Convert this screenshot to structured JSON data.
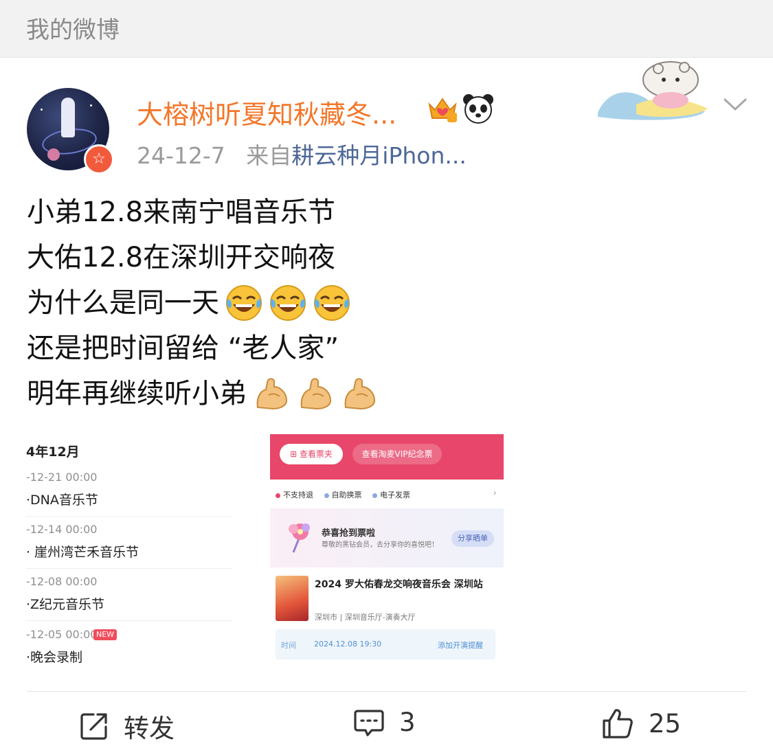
{
  "header": {
    "title": "我的微博"
  },
  "post": {
    "author": {
      "name": "大榕树听夏知秋藏冬...",
      "verified_badge": "☆",
      "badges": [
        "crown-icon",
        "panda-icon"
      ]
    },
    "date": "24-12-7",
    "source_prefix": "来自",
    "source": "耕云种月iPhon...",
    "lines": [
      "小弟12.8来南宁唱音乐节",
      "大佑12.8在深圳开交响夜",
      "为什么是同一天",
      "还是把时间留给 “老人家”",
      "明年再继续听小弟"
    ],
    "line3_emoji": "laughing-crying-emoji",
    "line5_emoji": "flexed-biceps-emoji"
  },
  "left_image": {
    "month": "4年12月",
    "events": [
      {
        "date": "-12-21 00:00",
        "name": "·DNA音乐节",
        "new": false
      },
      {
        "date": "-12-14 00:00",
        "name": "· 崖州湾芒禾音乐节",
        "new": false
      },
      {
        "date": "-12-08 00:00",
        "name": "·Z纪元音乐节",
        "new": false
      },
      {
        "date": "-12-05 00:00",
        "name": "·晚会录制",
        "new": true
      }
    ],
    "new_label": "NEW"
  },
  "right_image": {
    "btn_ticket": "⊞ 查看票夹",
    "btn_vip": "查看淘麦VIP纪念票",
    "tags": [
      "不支持退",
      "自助换票",
      "电子发票"
    ],
    "success_title": "恭喜抢到票啦",
    "success_sub": "尊敬的黑钻会员，去分享你的喜悦吧！",
    "share_label": "分享晒单",
    "concert_title": "2024 罗大佑春龙交响夜音乐会 深圳站",
    "venue": "深圳市 | 深圳音乐厅-演奏大厅",
    "time_label": "时间",
    "time_value": "2024.12.08 19:30",
    "reminder_label": "添加开演提醒"
  },
  "actions": {
    "repost": "转发",
    "comments": "3",
    "likes": "25"
  },
  "colors": {
    "username": "#f3772a",
    "source_link": "#4d6798",
    "ticket_pink": "#e8466a"
  }
}
